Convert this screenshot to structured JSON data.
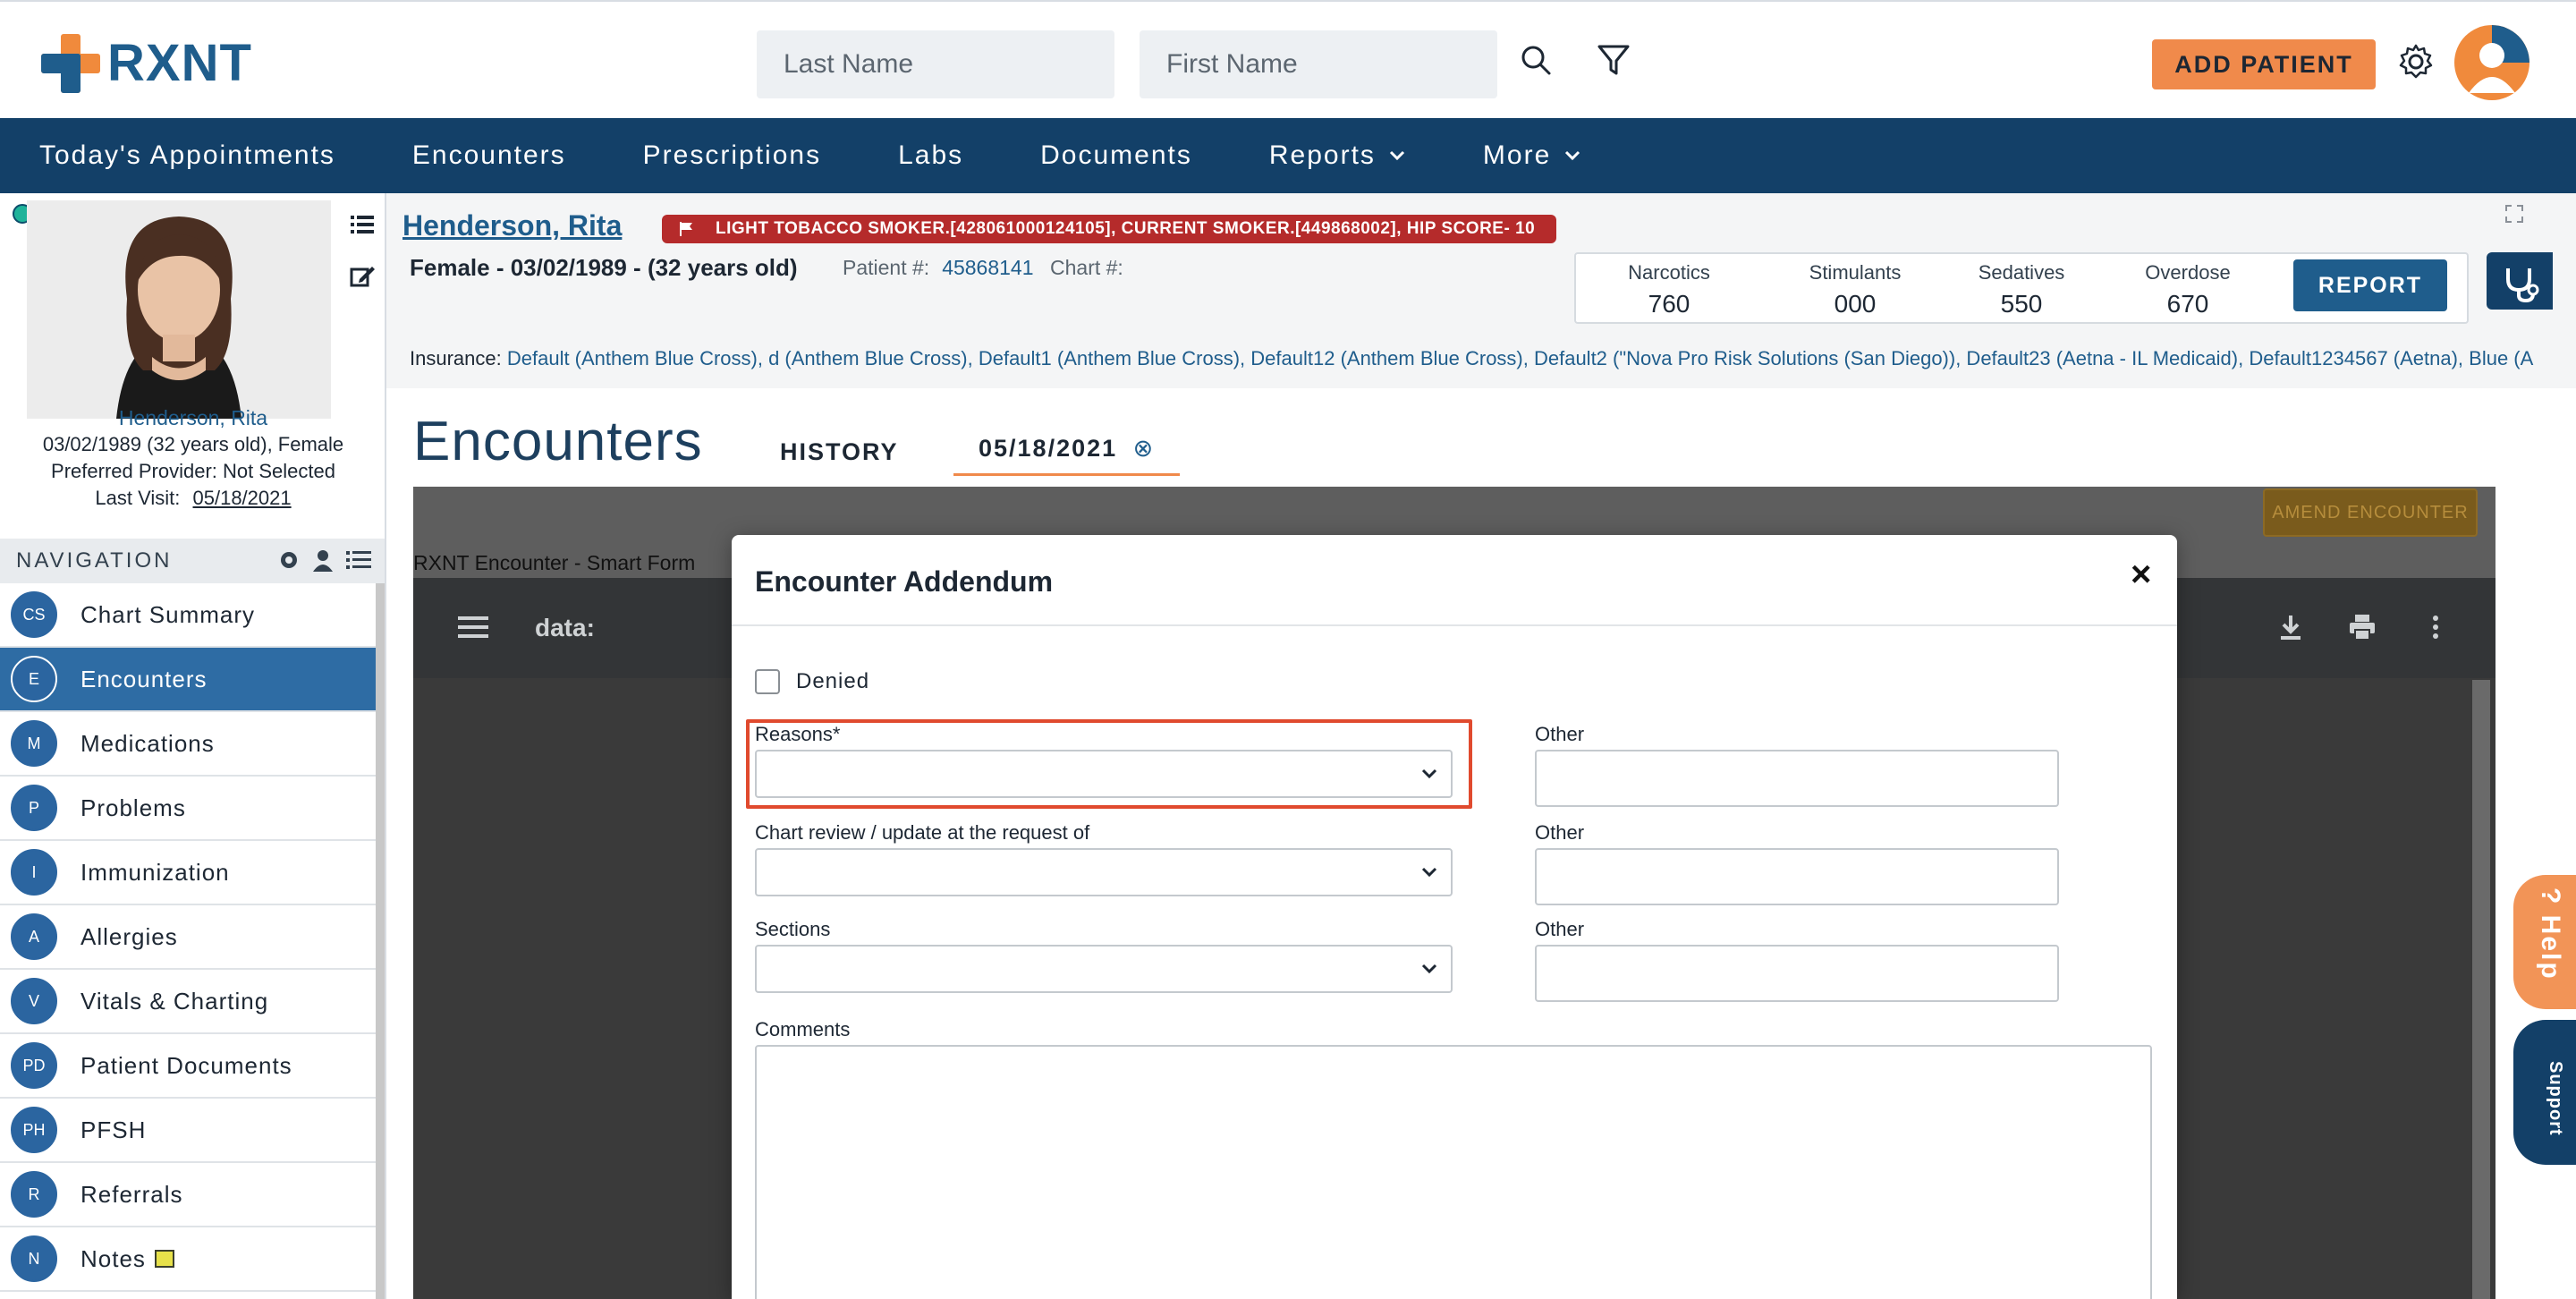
{
  "app": {
    "logo_text": "RXNT",
    "brand_orange": "#f08a3c",
    "brand_blue": "#1f5d8c",
    "nav_blue": "#134068"
  },
  "header": {
    "last_name_placeholder": "Last Name",
    "first_name_placeholder": "First Name",
    "add_patient_label": "ADD PATIENT",
    "icons": [
      "search-icon",
      "filter-icon",
      "gear-icon",
      "user-avatar"
    ]
  },
  "nav": {
    "items": [
      {
        "label": "Today's Appointments"
      },
      {
        "label": "Encounters"
      },
      {
        "label": "Prescriptions"
      },
      {
        "label": "Labs"
      },
      {
        "label": "Documents"
      },
      {
        "label": "Reports"
      },
      {
        "label": "More"
      }
    ]
  },
  "left_panel": {
    "patient_name": "Henderson, Rita",
    "dob_line": "03/02/1989 (32 years old), Female",
    "provider_line": "Preferred Provider: Not Selected",
    "last_visit_label": "Last Visit:",
    "last_visit_value": "05/18/2021",
    "navigation_header": "NAVIGATION",
    "items": [
      {
        "badge": "CS",
        "label": "Chart Summary"
      },
      {
        "badge": "E",
        "label": "Encounters",
        "active": true
      },
      {
        "badge": "M",
        "label": "Medications"
      },
      {
        "badge": "P",
        "label": "Problems"
      },
      {
        "badge": "I",
        "label": "Immunization"
      },
      {
        "badge": "A",
        "label": "Allergies"
      },
      {
        "badge": "V",
        "label": "Vitals & Charting"
      },
      {
        "badge": "PD",
        "label": "Patient Documents"
      },
      {
        "badge": "PH",
        "label": "PFSH"
      },
      {
        "badge": "R",
        "label": "Referrals"
      },
      {
        "badge": "N",
        "label": "Notes"
      }
    ]
  },
  "patient_header": {
    "name": "Henderson, Rita",
    "flag_text": "LIGHT TOBACCO SMOKER.[428061000124105], CURRENT SMOKER.[449868002], HIP SCORE- 10",
    "demographics": "Female - 03/02/1989 - (32 years old)",
    "patient_num_label": "Patient #:",
    "patient_num_value": "45868141",
    "chart_num_label": "Chart #:",
    "stats": [
      {
        "label": "Narcotics",
        "value": "760"
      },
      {
        "label": "Stimulants",
        "value": "000"
      },
      {
        "label": "Sedatives",
        "value": "550"
      },
      {
        "label": "Overdose",
        "value": "670"
      }
    ],
    "report_label": "REPORT",
    "insurance_label": "Insurance:",
    "insurance_value": "Default (Anthem Blue Cross), d (Anthem Blue Cross), Default1 (Anthem Blue Cross), Default12 (Anthem Blue Cross), Default2 (\"Nova Pro Risk Solutions (San Diego)), Default23 (Aetna - IL Medicaid), Default1234567 (Aetna), Blue (A"
  },
  "encounters": {
    "title": "Encounters",
    "tab_history": "HISTORY",
    "tab_date": "05/18/2021",
    "tab_close": "⊗",
    "amend_label": "AMEND ENCOUNTER",
    "frame_label": "RXNT Encounter - Smart Form",
    "viewer_label": "data:"
  },
  "modal": {
    "title": "Encounter Addendum",
    "close": "×",
    "denied_label": "Denied",
    "reasons_label": "Reasons*",
    "chart_review_label": "Chart review / update at the request of",
    "sections_label": "Sections",
    "other_label": "Other",
    "comments_label": "Comments",
    "highlight_color": "#e04a2e"
  },
  "help": {
    "help_label": "? Help",
    "support_label": "Support"
  }
}
